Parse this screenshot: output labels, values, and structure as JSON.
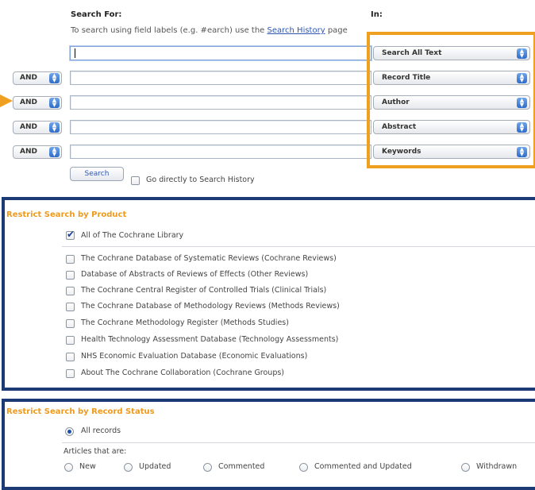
{
  "search_form": {
    "search_for_label": "Search For:",
    "in_label": "In:",
    "hint_text": "To search using field labels (e.g. #earch) use the",
    "hint_link": "Search History",
    "hint_suffix": "page",
    "rows": [
      {
        "operator": null,
        "value": "",
        "field": "Search All Text"
      },
      {
        "operator": "AND",
        "value": "",
        "field": "Record Title"
      },
      {
        "operator": "AND",
        "value": "",
        "field": "Author"
      },
      {
        "operator": "AND",
        "value": "",
        "field": "Abstract"
      },
      {
        "operator": "AND",
        "value": "",
        "field": "Keywords"
      }
    ],
    "search_button": "Search",
    "go_directly_label": "Go directly to Search History"
  },
  "restrict_product": {
    "heading": "Restrict Search by Product",
    "all_label": "All of The Cochrane Library",
    "all_checked": true,
    "items": [
      "The Cochrane Database of Systematic Reviews (Cochrane Reviews)",
      "Database of Abstracts of Reviews of Effects (Other Reviews)",
      "The Cochrane Central Register of Controlled Trials (Clinical Trials)",
      "The Cochrane Database of Methodology Reviews (Methods Reviews)",
      "The Cochrane Methodology Register (Methods Studies)",
      "Health Technology Assessment Database (Technology Assessments)",
      "NHS Economic Evaluation Database (Economic Evaluations)",
      "About The Cochrane Collaboration (Cochrane Groups)"
    ]
  },
  "restrict_status": {
    "heading": "Restrict Search by Record Status",
    "all_records_label": "All records",
    "articles_label": "Articles that are:",
    "options": [
      "New",
      "Updated",
      "Commented",
      "Commented and Updated",
      "Withdrawn"
    ]
  },
  "colors": {
    "highlight_orange": "#f0a020",
    "frame_navy": "#1c3a73",
    "link_blue": "#2d56b3"
  }
}
